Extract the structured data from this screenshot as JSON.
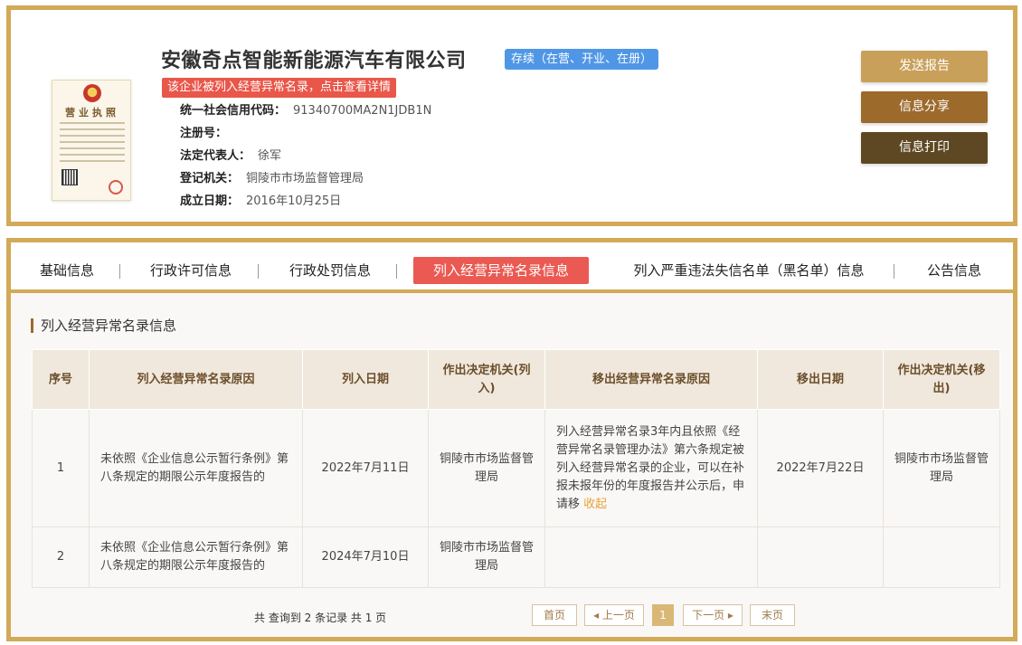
{
  "company": {
    "name": "安徽奇点智能新能源汽车有限公司",
    "status": "存续（在营、开业、在册）",
    "abnormal_notice": "该企业被列入经营异常名录，点击查看详情",
    "license_title": "营业执照",
    "fields": [
      {
        "label": "统一社会信用代码：",
        "value": "91340700MA2N1JDB1N"
      },
      {
        "label": "注册号：",
        "value": ""
      },
      {
        "label": "法定代表人：",
        "value": "徐军"
      },
      {
        "label": "登记机关：",
        "value": "铜陵市市场监督管理局"
      },
      {
        "label": "成立日期：",
        "value": "2016年10月25日"
      }
    ]
  },
  "actions": {
    "report": "发送报告",
    "share": "信息分享",
    "print": "信息打印"
  },
  "tabs": [
    {
      "label": "基础信息"
    },
    {
      "label": "行政许可信息"
    },
    {
      "label": "行政处罚信息"
    },
    {
      "label": "列入经营异常名录信息"
    },
    {
      "label": "列入严重违法失信名单（黑名单）信息"
    },
    {
      "label": "公告信息"
    }
  ],
  "section_title": "列入经营异常名录信息",
  "table": {
    "headers": [
      "序号",
      "列入经营异常名录原因",
      "列入日期",
      "作出决定机关(列入)",
      "移出经营异常名录原因",
      "移出日期",
      "作出决定机关(移出)"
    ],
    "rows": [
      {
        "no": "1",
        "reason": "未依照《企业信息公示暂行条例》第八条规定的期限公示年度报告的",
        "date_in": "2022年7月11日",
        "authority_in": "铜陵市市场监督管理局",
        "remove_reason": "列入经营异常名录3年内且依照《经营异常名录管理办法》第六条规定被列入经营异常名录的企业，可以在补报未报年份的年度报告并公示后，申请移",
        "collapse": "收起",
        "date_out": "2022年7月22日",
        "authority_out": "铜陵市市场监督管理局"
      },
      {
        "no": "2",
        "reason": "未依照《企业信息公示暂行条例》第八条规定的期限公示年度报告的",
        "date_in": "2024年7月10日",
        "authority_in": "铜陵市市场监督管理局",
        "remove_reason": "",
        "collapse": "",
        "date_out": "",
        "authority_out": ""
      }
    ]
  },
  "pagination": {
    "summary": "共 查询到 2 条记录 共 1 页",
    "first": "首页",
    "prev": "上一页",
    "current": "1",
    "next": "下一页",
    "last": "末页"
  }
}
